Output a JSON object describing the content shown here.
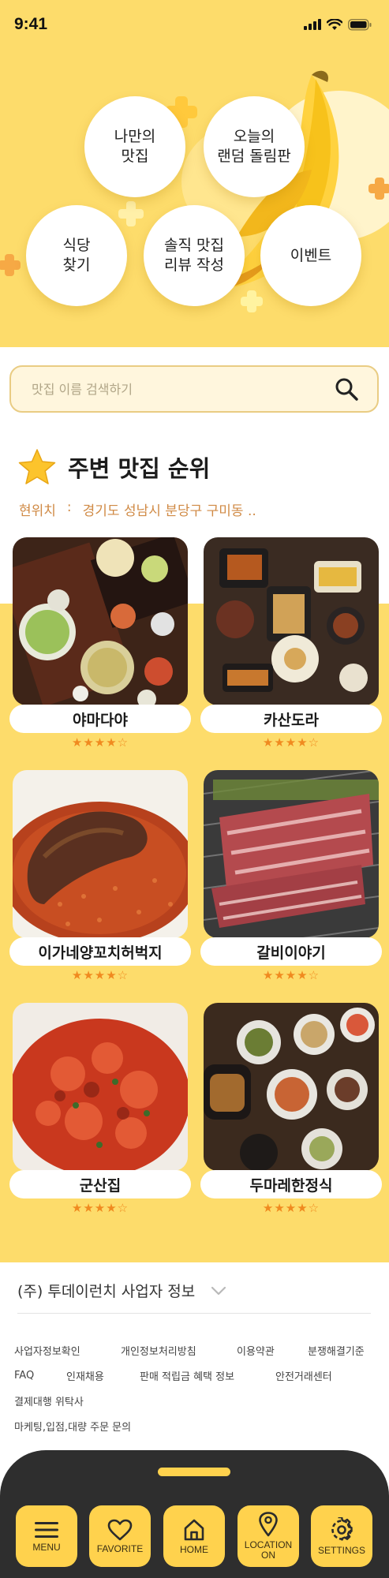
{
  "status_bar": {
    "time": "9:41"
  },
  "hero": {
    "bubbles": [
      {
        "label": "나만의\n맛집"
      },
      {
        "label": "오늘의\n랜덤 돌림판"
      },
      {
        "label": "식당\n찾기"
      },
      {
        "label": "솔직 맛집\n리뷰 작성"
      },
      {
        "label": "이벤트"
      }
    ]
  },
  "search": {
    "placeholder": "맛집 이름 검색하기"
  },
  "ranking": {
    "title": "주변 맛집 순위",
    "location_label": "현위치",
    "location_separator": ":",
    "location_value": "경기도 성남시 분당구 구미동 .."
  },
  "restaurants": [
    {
      "name": "야마다야",
      "stars": "★★★★☆"
    },
    {
      "name": "카산도라",
      "stars": "★★★★☆"
    },
    {
      "name": "이가네양꼬치허벅지",
      "stars": "★★★★☆"
    },
    {
      "name": "갈비이야기",
      "stars": "★★★★☆"
    },
    {
      "name": "군산집",
      "stars": "★★★★☆"
    },
    {
      "name": "두마레한정식",
      "stars": "★★★★☆"
    }
  ],
  "footer": {
    "company": "(주) 투데이런치 사업자 정보",
    "links_rows": [
      [
        "사업자정보확인",
        "개인정보처리방침",
        "이용약관",
        "분쟁해결기준"
      ],
      [
        "FAQ",
        "인재채용",
        "판매 적립금 혜택 정보",
        "안전거래센터"
      ],
      [
        "결제대행 위탁사"
      ],
      [
        "마케팅,입점,대량 주문 문의"
      ]
    ]
  },
  "nav": {
    "items": [
      {
        "label": "MENU",
        "icon": "menu-icon"
      },
      {
        "label": "FAVORITE",
        "icon": "heart-icon"
      },
      {
        "label": "HOME",
        "icon": "home-icon"
      },
      {
        "label": "LOCATION\nON",
        "icon": "location-pin-icon"
      },
      {
        "label": "SETTINGS",
        "icon": "gear-icon"
      }
    ]
  },
  "colors": {
    "primary_yellow": "#fddc6b",
    "nav_yellow": "#ffd24d",
    "accent_orange": "#f08a1f",
    "location_text": "#d08a45",
    "nav_bg": "#2e2e2e"
  }
}
